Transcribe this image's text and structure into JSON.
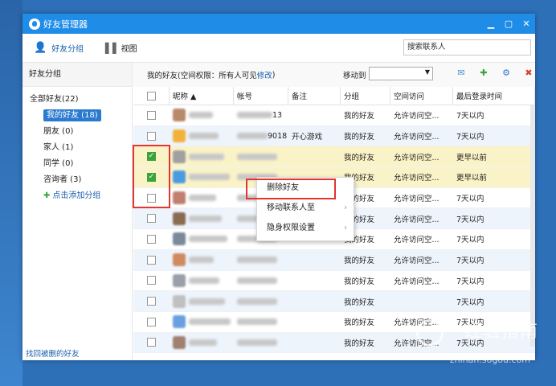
{
  "window": {
    "title": "好友管理器"
  },
  "tabs": [
    {
      "label": "好友分组"
    },
    {
      "label": "视图"
    }
  ],
  "search": {
    "placeholder": "搜索联系人"
  },
  "sidebar": {
    "heading": "好友分组",
    "all": "全部好友(22)",
    "groups": [
      {
        "label": "我的好友 (18)",
        "selected": true
      },
      {
        "label": "朋友 (0)"
      },
      {
        "label": "家人 (1)"
      },
      {
        "label": "同学 (0)"
      },
      {
        "label": "咨询者 (3)"
      }
    ],
    "add": "点击添加分组",
    "recover": "找回被删的好友"
  },
  "main": {
    "head_prefix": "我的好友(空间权限：所有人可见",
    "head_link": "修改",
    "head_suffix": ")",
    "move_to": "移动到"
  },
  "columns": [
    "昵称 ▲",
    "帐号",
    "备注",
    "分组",
    "空间访问",
    "最后登录时间"
  ],
  "rows": [
    {
      "account_suffix": "13",
      "remark": "",
      "group": "我的好友",
      "access": "允许访问空...",
      "last": "7天以内"
    },
    {
      "account_suffix": "9018",
      "remark": "开心游戏",
      "group": "我的好友",
      "access": "允许访问空...",
      "last": "7天以内"
    },
    {
      "account_suffix": "",
      "remark": "",
      "group": "我的好友",
      "access": "允许访问空...",
      "last": "更早以前",
      "checked": true
    },
    {
      "account_suffix": "",
      "remark": "",
      "group": "我的好友",
      "access": "允许访问空...",
      "last": "更早以前",
      "checked": true
    },
    {
      "account_suffix": "",
      "remark": "",
      "group": "我的好友",
      "access": "允许访问空...",
      "last": "7天以内"
    },
    {
      "account_suffix": "",
      "remark": "",
      "group": "我的好友",
      "access": "允许访问空...",
      "last": "7天以内"
    },
    {
      "account_suffix": "",
      "remark": "",
      "group": "我的好友",
      "access": "允许访问空...",
      "last": "7天以内"
    },
    {
      "account_suffix": "",
      "remark": "",
      "group": "我的好友",
      "access": "允许访问空...",
      "last": "7天以内"
    },
    {
      "account_suffix": "",
      "remark": "",
      "group": "我的好友",
      "access": "允许访问空...",
      "last": "7天以内"
    },
    {
      "account_suffix": "",
      "remark": "",
      "group": "我的好友",
      "access": "",
      "last": "7天以内"
    },
    {
      "account_suffix": "",
      "remark": "",
      "group": "我的好友",
      "access": "允许访问空...",
      "last": "7天以内"
    },
    {
      "account_suffix": "",
      "remark": "",
      "group": "我的好友",
      "access": "允许访问空...",
      "last": "7天以内"
    }
  ],
  "context_menu": {
    "items": [
      "删除好友",
      "移动联系人至",
      "隐身权限设置"
    ]
  },
  "watermark": {
    "text": "经验指南",
    "sub": "zhinan.sogou.com"
  },
  "colors": {
    "titlebar": "#1f8de8",
    "selected": "#2a7ad0",
    "highlight": "#e2362f",
    "checked_row": "#fbf3c8"
  }
}
